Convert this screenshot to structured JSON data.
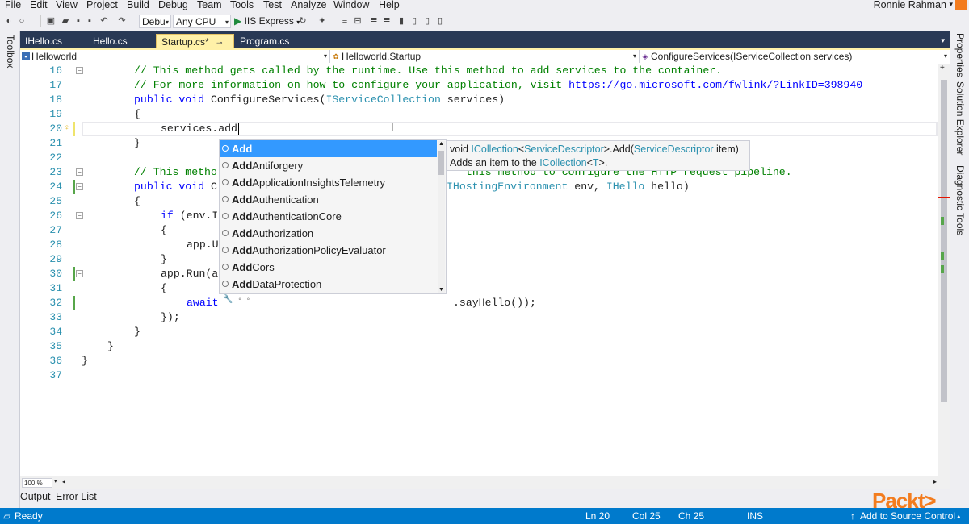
{
  "menu": {
    "items": [
      "File",
      "Edit",
      "View",
      "Project",
      "Build",
      "Debug",
      "Team",
      "Tools",
      "Test",
      "Analyze",
      "Window",
      "Help"
    ],
    "user": "Ronnie Rahman"
  },
  "toolbar": {
    "config": "Debu",
    "platform": "Any CPU",
    "run_target": "IIS Express"
  },
  "side": {
    "left": "Toolbox",
    "right": [
      "Properties",
      "Solution Explorer",
      "Diagnostic Tools"
    ]
  },
  "tabs": [
    {
      "label": "IHello.cs",
      "active": false
    },
    {
      "label": "Hello.cs",
      "active": false
    },
    {
      "label": "Startup.cs*",
      "active": true
    },
    {
      "label": "Program.cs",
      "active": false
    }
  ],
  "nav": {
    "project": "Helloworld",
    "class": "Helloworld.Startup",
    "member": "ConfigureServices(IServiceCollection services)"
  },
  "lines": {
    "l16": "16",
    "l17": "17",
    "l18": "18",
    "l19": "19",
    "l20": "20",
    "l21": "21",
    "l22": "22",
    "l23": "23",
    "l24": "24",
    "l25": "25",
    "l26": "26",
    "l27": "27",
    "l28": "28",
    "l29": "29",
    "l30": "30",
    "l31": "31",
    "l32": "32",
    "l33": "33",
    "l34": "34",
    "l35": "35",
    "l36": "36",
    "l37": "37"
  },
  "code": {
    "c16": "// This method gets called by the runtime. Use this method to add services to the container.",
    "c17a": "// For more information on how to configure your application, visit ",
    "c17link": "https://go.microsoft.com/fwlink/?LinkID=398940",
    "c18_kw": "public void",
    "c18_name": " ConfigureServices(",
    "c18_type": "IServiceCollection",
    "c18_rest": " services)",
    "c19": "{",
    "c20": "services.add",
    "c21": "}",
    "c23a": "// This metho",
    "c23b": "this method to configure the HTTP request pipeline.",
    "c24_kw": "public void",
    "c24_c": " C",
    "c24_type": "IHostingEnvironment",
    "c24_mid": " env, ",
    "c24_type2": "IHello",
    "c24_end": " hello)",
    "c25": "{",
    "c26_kw": "if",
    "c26_rest": " (env.I",
    "c27": "{",
    "c28": "app.U",
    "c29": "}",
    "c30": "app.Run(a",
    "c31": "{",
    "c32_kw": "await",
    "c32_rest": ".sayHello());",
    "c33": "});",
    "c34": "}",
    "c35": "}",
    "c36": "}"
  },
  "intellisense": {
    "items": [
      {
        "bold": "Add",
        "rest": ""
      },
      {
        "bold": "Add",
        "rest": "Antiforgery"
      },
      {
        "bold": "Add",
        "rest": "ApplicationInsightsTelemetry"
      },
      {
        "bold": "Add",
        "rest": "Authentication"
      },
      {
        "bold": "Add",
        "rest": "AuthenticationCore"
      },
      {
        "bold": "Add",
        "rest": "Authorization"
      },
      {
        "bold": "Add",
        "rest": "AuthorizationPolicyEvaluator"
      },
      {
        "bold": "Add",
        "rest": "Cors"
      },
      {
        "bold": "Add",
        "rest": "DataProtection"
      }
    ],
    "tooltip_sig_a": "void ",
    "tooltip_sig_type1": "ICollection",
    "tooltip_sig_b": "<",
    "tooltip_sig_type2": "ServiceDescriptor",
    "tooltip_sig_c": ">.Add(",
    "tooltip_sig_type3": "ServiceDescriptor",
    "tooltip_sig_d": " item)",
    "tooltip_desc_a": "Adds an item to the ",
    "tooltip_desc_type": "ICollection",
    "tooltip_desc_b": "<",
    "tooltip_desc_type2": "T",
    "tooltip_desc_c": ">."
  },
  "editor": {
    "zoom": "100 %"
  },
  "output_tabs": [
    "Output",
    "Error List"
  ],
  "status": {
    "ready": "Ready",
    "ln": "Ln 20",
    "col": "Col 25",
    "ch": "Ch 25",
    "ins": "INS",
    "source": "Add to Source Control"
  },
  "brand": "Packt>"
}
